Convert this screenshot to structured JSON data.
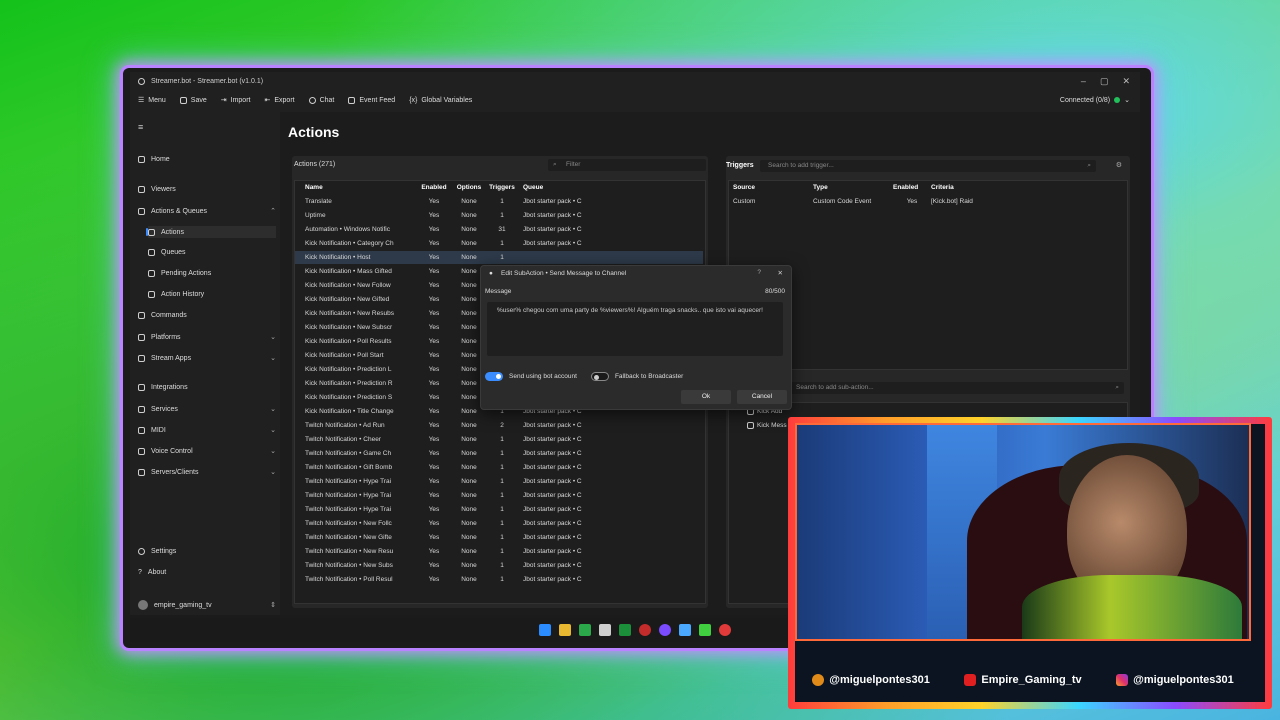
{
  "window": {
    "title": "Streamer.bot - Streamer.bot (v1.0.1)",
    "controls": [
      "–",
      "▢",
      "✕"
    ]
  },
  "toolbar": {
    "menu": "Menu",
    "save": "Save",
    "import": "Import",
    "export": "Export",
    "chat": "Chat",
    "event_feed": "Event Feed",
    "global_variables": "Global Variables",
    "connected": "Connected (0/8)"
  },
  "sidebar": {
    "home": "Home",
    "viewers": "Viewers",
    "actions_queues": "Actions & Queues",
    "actions": "Actions",
    "queues": "Queues",
    "pending_actions": "Pending Actions",
    "action_history": "Action History",
    "commands": "Commands",
    "platforms": "Platforms",
    "stream_apps": "Stream Apps",
    "integrations": "Integrations",
    "services": "Services",
    "midi": "MIDI",
    "voice_control": "Voice Control",
    "servers_clients": "Servers/Clients",
    "settings": "Settings",
    "about": "About",
    "user": "empire_gaming_tv"
  },
  "page": {
    "title": "Actions"
  },
  "actions_panel": {
    "heading": "Actions (271)",
    "filter_placeholder": "Filter",
    "columns": [
      "Name",
      "Enabled",
      "Options",
      "Triggers",
      "Queue"
    ],
    "rows": [
      [
        "Translate",
        "Yes",
        "None",
        "1",
        "Jbot starter pack • C"
      ],
      [
        "Uptime",
        "Yes",
        "None",
        "1",
        "Jbot starter pack • C"
      ],
      [
        "Automation • Windows Notific",
        "Yes",
        "None",
        "31",
        "Jbot starter pack • C"
      ],
      [
        "Kick Notification • Category Ch",
        "Yes",
        "None",
        "1",
        "Jbot starter pack • C"
      ],
      [
        "Kick Notification • Host",
        "Yes",
        "None",
        "1",
        ""
      ],
      [
        "Kick Notification • Mass Gifted",
        "Yes",
        "None",
        "",
        ""
      ],
      [
        "Kick Notification • New Follow",
        "Yes",
        "None",
        "",
        ""
      ],
      [
        "Kick Notification • New Gifted",
        "Yes",
        "None",
        "",
        ""
      ],
      [
        "Kick Notification • New Resubs",
        "Yes",
        "None",
        "",
        ""
      ],
      [
        "Kick Notification • New Subscr",
        "Yes",
        "None",
        "",
        ""
      ],
      [
        "Kick Notification • Poll Results",
        "Yes",
        "None",
        "",
        ""
      ],
      [
        "Kick Notification • Poll Start",
        "Yes",
        "None",
        "",
        ""
      ],
      [
        "Kick Notification • Prediction L",
        "Yes",
        "None",
        "",
        ""
      ],
      [
        "Kick Notification • Prediction R",
        "Yes",
        "None",
        "",
        ""
      ],
      [
        "Kick Notification • Prediction S",
        "Yes",
        "None",
        "",
        ""
      ],
      [
        "Kick Notification • Title Change",
        "Yes",
        "None",
        "1",
        "Jbot starter pack • C"
      ],
      [
        "Twitch Notification • Ad Run",
        "Yes",
        "None",
        "2",
        "Jbot starter pack • C"
      ],
      [
        "Twitch Notification • Cheer",
        "Yes",
        "None",
        "1",
        "Jbot starter pack • C"
      ],
      [
        "Twitch Notification • Game Ch",
        "Yes",
        "None",
        "1",
        "Jbot starter pack • C"
      ],
      [
        "Twitch Notification • Gift Bomb",
        "Yes",
        "None",
        "1",
        "Jbot starter pack • C"
      ],
      [
        "Twitch Notification • Hype Trai",
        "Yes",
        "None",
        "1",
        "Jbot starter pack • C"
      ],
      [
        "Twitch Notification • Hype Trai",
        "Yes",
        "None",
        "1",
        "Jbot starter pack • C"
      ],
      [
        "Twitch Notification • Hype Trai",
        "Yes",
        "None",
        "1",
        "Jbot starter pack • C"
      ],
      [
        "Twitch Notification • New Follc",
        "Yes",
        "None",
        "1",
        "Jbot starter pack • C"
      ],
      [
        "Twitch Notification • New Gifte",
        "Yes",
        "None",
        "1",
        "Jbot starter pack • C"
      ],
      [
        "Twitch Notification • New Resu",
        "Yes",
        "None",
        "1",
        "Jbot starter pack • C"
      ],
      [
        "Twitch Notification • New Subs",
        "Yes",
        "None",
        "1",
        "Jbot starter pack • C"
      ],
      [
        "Twitch Notification • Poll Resul",
        "Yes",
        "None",
        "1",
        "Jbot starter pack • C"
      ]
    ]
  },
  "triggers_panel": {
    "heading": "Triggers",
    "search_placeholder": "Search to add trigger...",
    "columns": [
      "Source",
      "Type",
      "Enabled",
      "Criteria"
    ],
    "rows": [
      [
        "Custom",
        "Custom Code Event",
        "Yes",
        "[Kick.bot] Raid"
      ]
    ]
  },
  "subactions_panel": {
    "search_placeholder": "Search to add sub-action...",
    "items": [
      "Kick Add",
      "Kick Mess"
    ]
  },
  "dialog": {
    "title": "Edit SubAction • Send Message to Channel",
    "message_label": "Message",
    "char_count": "80/500",
    "message_text": "%user% chegou com uma party de %viewers%! Alguém traga snacks.. que isto vai aquecer!",
    "send_bot_label": "Send using bot account",
    "fallback_label": "Fallback to Broadcaster",
    "ok": "Ok",
    "cancel": "Cancel"
  },
  "socials": {
    "kick": "@miguelpontes301",
    "youtube": "Empire_Gaming_tv",
    "instagram": "@miguelpontes301"
  }
}
